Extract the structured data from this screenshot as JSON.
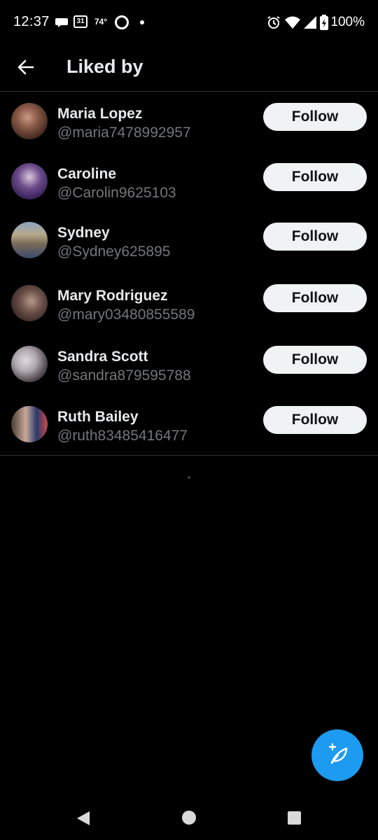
{
  "status_bar": {
    "time": "12:37",
    "calendar_day": "31",
    "weather": "74°",
    "battery": "100%"
  },
  "header": {
    "title": "Liked by"
  },
  "users": [
    {
      "name": "Maria Lopez",
      "handle": "@maria7478992957",
      "follow_label": "Follow"
    },
    {
      "name": "Caroline",
      "handle": "@Carolin9625103",
      "follow_label": "Follow"
    },
    {
      "name": "Sydney",
      "handle": "@Sydney625895",
      "follow_label": "Follow"
    },
    {
      "name": "Mary Rodriguez",
      "handle": "@mary03480855589",
      "follow_label": "Follow"
    },
    {
      "name": "Sandra Scott",
      "handle": "@sandra879595788",
      "follow_label": "Follow"
    },
    {
      "name": "Ruth Bailey",
      "handle": "@ruth83485416477",
      "follow_label": "Follow"
    }
  ],
  "icons": {
    "back": "arrow-left-icon",
    "compose": "feather-plus-icon",
    "nav_back": "triangle-back-icon",
    "nav_home": "circle-home-icon",
    "nav_recents": "square-recents-icon"
  },
  "colors": {
    "background": "#000000",
    "accent": "#1d9bf0",
    "divider": "#2f3336",
    "handle_text": "#71767b",
    "button_bg": "#eff3f4"
  }
}
